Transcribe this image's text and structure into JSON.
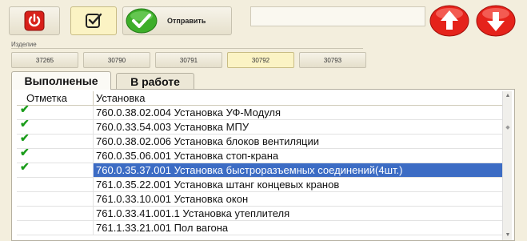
{
  "toolbar": {
    "power_icon": "power-icon",
    "check_icon": "checkbox-icon",
    "send_label": "Отправить",
    "message_value": "",
    "up_icon": "arrow-up-icon",
    "down_icon": "arrow-down-icon"
  },
  "product": {
    "group_label": "Изделие",
    "items": [
      "37265",
      "30790",
      "30791",
      "30792",
      "30793"
    ],
    "active_index": 3
  },
  "tabs": [
    {
      "label": "Выполненые",
      "active": true
    },
    {
      "label": "В работе",
      "active": false
    }
  ],
  "table": {
    "columns": [
      "Отметка",
      "Установка"
    ],
    "rows": [
      {
        "checked": true,
        "text": "760.0.38.02.004 Установка УФ-Модуля"
      },
      {
        "checked": true,
        "text": "760.0.33.54.003 Установка МПУ"
      },
      {
        "checked": true,
        "text": "760.0.38.02.006 Установка блоков вентиляции"
      },
      {
        "checked": true,
        "text": "760.0.35.06.001  Установка стоп-крана"
      },
      {
        "checked": true,
        "text": "760.0.35.37.001 Установка быстроразъемных соединений(4шт.)",
        "selected": true
      },
      {
        "checked": false,
        "text": "761.0.35.22.001 Установка штанг концевых кранов"
      },
      {
        "checked": false,
        "text": "761.0.33.10.001 Установка окон"
      },
      {
        "checked": false,
        "text": "761.0.33.41.001.1 Установка утеплителя"
      },
      {
        "checked": false,
        "text": "761.1.33.21.001 Пол вагона"
      }
    ],
    "check_glyph": "✔"
  },
  "colors": {
    "background": "#f3eedd",
    "selection": "#3c6cc4",
    "check": "#1a9c1a",
    "red_button": "#e5231b",
    "green_button": "#3eae2a"
  }
}
